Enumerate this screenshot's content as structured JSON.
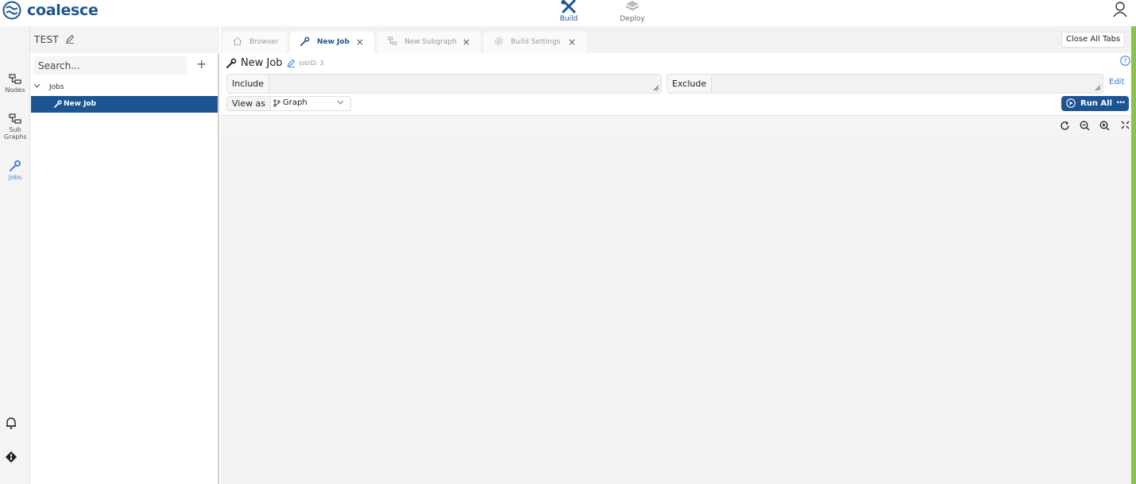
{
  "brand": {
    "name": "coalesce",
    "color": "#1d5592"
  },
  "topnav": [
    {
      "label": "Build",
      "icon": "build-icon",
      "active": true
    },
    {
      "label": "Deploy",
      "icon": "deploy-icon",
      "active": false
    }
  ],
  "project": {
    "name": "TEST"
  },
  "rail": [
    {
      "label": "Nodes",
      "icon": "nodes-icon"
    },
    {
      "label": "Sub Graphs",
      "icon": "subgraphs-icon"
    },
    {
      "label": "Jobs",
      "icon": "wrench-icon",
      "active": true
    }
  ],
  "explorer": {
    "search_placeholder": "Search...",
    "add_label": "+",
    "group_label": "Jobs",
    "selected_item": "New Job"
  },
  "tabs": [
    {
      "label": "Browser",
      "icon": "home-icon",
      "active": false,
      "closable": false
    },
    {
      "label": "New Job",
      "icon": "wrench-icon",
      "active": true,
      "closable": true
    },
    {
      "label": "New Subgraph",
      "icon": "subgraph-icon",
      "active": false,
      "closable": true
    },
    {
      "label": "Build Settings",
      "icon": "gear-icon",
      "active": false,
      "closable": true
    }
  ],
  "close_all_label": "Close All Tabs",
  "job": {
    "title": "New Job",
    "id_text": "jobID: 3",
    "include_label": "Include",
    "exclude_label": "Exclude",
    "edit_label": "Edit",
    "view_as_label": "View as",
    "view_as_value": "Graph",
    "run_all_label": "Run All",
    "more_label": "···"
  },
  "colors": {
    "accent": "#1d5592",
    "link": "#2a7dd1",
    "strip": "#8bc34a"
  }
}
